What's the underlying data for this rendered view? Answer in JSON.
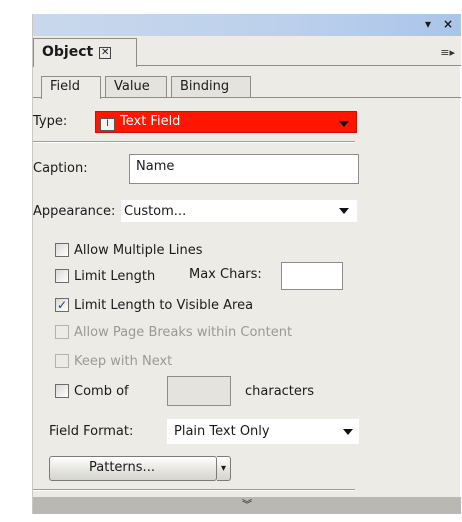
{
  "titlebar": {
    "menu_glyph": "▾",
    "close_glyph": "×"
  },
  "panel": {
    "tab_label": "Object",
    "tab_close_glyph": "✕",
    "menu_icon_glyph": "≡▸"
  },
  "subtabs": [
    {
      "label": "Field",
      "active": true
    },
    {
      "label": "Value",
      "active": false
    },
    {
      "label": "Binding",
      "active": false
    }
  ],
  "type": {
    "label": "Type:",
    "value": "Text Field",
    "icon_glyph": "I",
    "highlight_color": "#ff1500"
  },
  "caption": {
    "label": "Caption:",
    "value": "Name"
  },
  "appearance": {
    "label": "Appearance:",
    "value": "Custom..."
  },
  "options": {
    "allow_multiple_lines": {
      "label": "Allow Multiple Lines",
      "checked": false,
      "enabled": true
    },
    "limit_length": {
      "label": "Limit Length",
      "checked": false,
      "enabled": true
    },
    "max_chars_label": "Max Chars:",
    "max_chars_value": "",
    "limit_visible": {
      "label": "Limit Length to Visible Area",
      "checked": true,
      "enabled": true
    },
    "allow_page_breaks": {
      "label": "Allow Page Breaks within Content",
      "checked": false,
      "enabled": false
    },
    "keep_with_next": {
      "label": "Keep with Next",
      "checked": false,
      "enabled": false
    },
    "comb_of": {
      "label": "Comb of",
      "checked": false,
      "enabled": true
    },
    "comb_chars_value": "",
    "characters_label": "characters"
  },
  "field_format": {
    "label": "Field Format:",
    "value": "Plain Text Only"
  },
  "patterns_button": {
    "label": "Patterns...",
    "arrow_glyph": "▾"
  },
  "footer": {
    "expand_glyph": "︾"
  }
}
